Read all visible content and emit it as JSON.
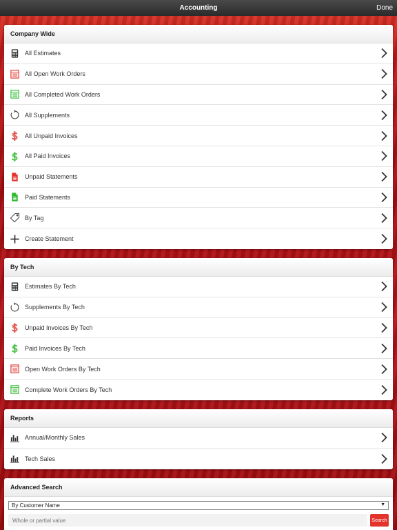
{
  "header": {
    "title": "Accounting",
    "done_label": "Done"
  },
  "company_wide": {
    "title": "Company Wide",
    "items": [
      {
        "label": "All Estimates",
        "icon": "calculator-icon"
      },
      {
        "label": "All Open Work Orders",
        "icon": "work-order-red-icon"
      },
      {
        "label": "All Completed Work Orders",
        "icon": "work-order-green-icon"
      },
      {
        "label": "All Supplements",
        "icon": "refresh-icon"
      },
      {
        "label": "All Unpaid Invoices",
        "icon": "dollar-red-icon"
      },
      {
        "label": "All Paid Invoices",
        "icon": "dollar-green-icon"
      },
      {
        "label": "Unpaid Statements",
        "icon": "document-red-icon"
      },
      {
        "label": "Paid Statements",
        "icon": "document-green-icon"
      },
      {
        "label": "By Tag",
        "icon": "tag-icon"
      },
      {
        "label": "Create Statement",
        "icon": "plus-icon"
      }
    ]
  },
  "by_tech": {
    "title": "By Tech",
    "items": [
      {
        "label": "Estimates By Tech",
        "icon": "calculator-icon"
      },
      {
        "label": "Supplements By Tech",
        "icon": "refresh-icon"
      },
      {
        "label": "Unpaid Invoices By Tech",
        "icon": "dollar-red-icon"
      },
      {
        "label": "Paid Invoices By Tech",
        "icon": "dollar-green-icon"
      },
      {
        "label": "Open Work Orders By Tech",
        "icon": "work-order-red-icon"
      },
      {
        "label": "Complete Work Orders By Tech",
        "icon": "work-order-green-icon"
      }
    ]
  },
  "reports": {
    "title": "Reports",
    "items": [
      {
        "label": "Annual/Monthly Sales",
        "icon": "bar-chart-icon"
      },
      {
        "label": "Tech Sales",
        "icon": "bar-chart-icon"
      }
    ]
  },
  "advanced_search": {
    "title": "Advanced Search",
    "select_value": "By Customer Name",
    "input_placeholder": "Whole or partial value",
    "search_label": "Search"
  },
  "colors": {
    "red": "#e2332c",
    "green": "#2fb82f",
    "dark": "#333333"
  }
}
